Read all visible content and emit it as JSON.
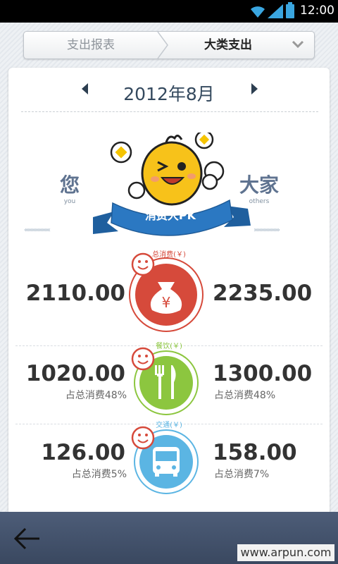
{
  "status": {
    "time": "12:00"
  },
  "dropdown": {
    "left_label": "支出报表",
    "right_label": "大类支出"
  },
  "month": {
    "label": "2012年8月"
  },
  "compare": {
    "you_label": "您",
    "you_sub": "you",
    "others_label": "大家",
    "others_sub": "others",
    "banner": "消费大PK"
  },
  "rows": [
    {
      "category": "总消费(￥)",
      "you_value": "2110.00",
      "others_value": "2235.00",
      "you_pct": "",
      "others_pct": "",
      "color": "#d64a3b",
      "icon": "money-bag-icon"
    },
    {
      "category": "餐饮(￥)",
      "you_value": "1020.00",
      "others_value": "1300.00",
      "you_pct": "占总消费48%",
      "others_pct": "占总消费48%",
      "color": "#8cc63f",
      "icon": "fork-knife-icon"
    },
    {
      "category": "交通(￥)",
      "you_value": "126.00",
      "others_value": "158.00",
      "you_pct": "占总消费5%",
      "others_pct": "占总消费7%",
      "color": "#5bb5e3",
      "icon": "bus-icon"
    }
  ],
  "watermark": "www.arpun.com"
}
